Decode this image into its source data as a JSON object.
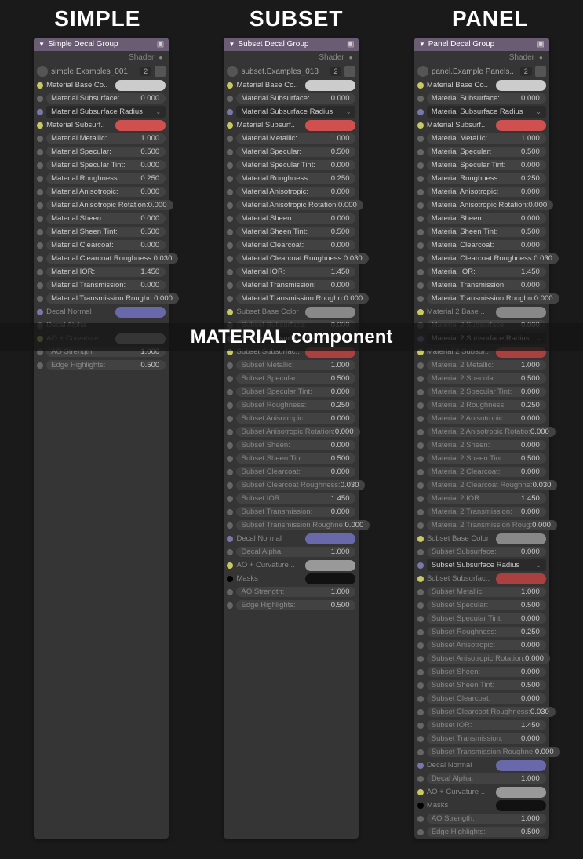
{
  "titles": {
    "simple": "SIMPLE",
    "subset": "SUBSET",
    "panel": "PANEL"
  },
  "overlay": "MATERIAL component",
  "shader_label": "Shader",
  "simple": {
    "header": "Simple Decal Group",
    "example": "simple.Examples_001",
    "count": "2",
    "rows": [
      {
        "dot": "yellow",
        "label": "Material Base Co..",
        "swatch": "#cccccc"
      },
      {
        "dot": "gray",
        "label": "Material Subsurface:",
        "value": "0.000",
        "field": true
      },
      {
        "dot": "purple",
        "select": "Material Subsurface Radius"
      },
      {
        "dot": "yellow",
        "label": "Material Subsurf..",
        "swatch": "#d05050"
      },
      {
        "dot": "gray",
        "label": "Material Metallic:",
        "value": "1.000",
        "field": true
      },
      {
        "dot": "gray",
        "label": "Material Specular:",
        "value": "0.500",
        "field": true
      },
      {
        "dot": "gray",
        "label": "Material Specular Tint:",
        "value": "0.000",
        "field": true
      },
      {
        "dot": "gray",
        "label": "Material Roughness:",
        "value": "0.250",
        "field": true
      },
      {
        "dot": "gray",
        "label": "Material Anisotropic:",
        "value": "0.000",
        "field": true
      },
      {
        "dot": "gray",
        "label": "Material Anisotropic Rotation:",
        "value": "0.000",
        "field": true
      },
      {
        "dot": "gray",
        "label": "Material Sheen:",
        "value": "0.000",
        "field": true
      },
      {
        "dot": "gray",
        "label": "Material Sheen Tint:",
        "value": "0.500",
        "field": true
      },
      {
        "dot": "gray",
        "label": "Material Clearcoat:",
        "value": "0.000",
        "field": true
      },
      {
        "dot": "gray",
        "label": "Material Clearcoat Roughness:",
        "value": "0.030",
        "field": true
      },
      {
        "dot": "gray",
        "label": "Material IOR:",
        "value": "1.450",
        "field": true
      },
      {
        "dot": "gray",
        "label": "Material Transmission:",
        "value": "0.000",
        "field": true
      },
      {
        "dot": "gray",
        "label": "Material Transmission Roughn:",
        "value": "0.000",
        "field": true
      },
      {
        "dot": "purple",
        "label": "Decal Normal",
        "swatch": "#6868aa",
        "dim": true
      },
      {
        "dot": "gray",
        "label": "Decal Alpha",
        "dim": true
      },
      {
        "dot": "yellow",
        "label": "AO + Curvature ..",
        "swatch": "#999999",
        "dim": true
      },
      {
        "dot": "gray",
        "label": "AO Strength:",
        "value": "1.000",
        "field": true,
        "dim": true
      },
      {
        "dot": "gray",
        "label": "Edge Highlights:",
        "value": "0.500",
        "field": true,
        "dim": true
      }
    ]
  },
  "subset": {
    "header": "Subset Decal Group",
    "example": "subset.Examples_018",
    "count": "2",
    "rows": [
      {
        "dot": "yellow",
        "label": "Material Base Co..",
        "swatch": "#cccccc"
      },
      {
        "dot": "gray",
        "label": "Material Subsurface:",
        "value": "0.000",
        "field": true
      },
      {
        "dot": "purple",
        "select": "Material Subsurface Radius"
      },
      {
        "dot": "yellow",
        "label": "Material Subsurf..",
        "swatch": "#d05050"
      },
      {
        "dot": "gray",
        "label": "Material Metallic:",
        "value": "1.000",
        "field": true
      },
      {
        "dot": "gray",
        "label": "Material Specular:",
        "value": "0.500",
        "field": true
      },
      {
        "dot": "gray",
        "label": "Material Specular Tint:",
        "value": "0.000",
        "field": true
      },
      {
        "dot": "gray",
        "label": "Material Roughness:",
        "value": "0.250",
        "field": true
      },
      {
        "dot": "gray",
        "label": "Material Anisotropic:",
        "value": "0.000",
        "field": true
      },
      {
        "dot": "gray",
        "label": "Material Anisotropic Rotation:",
        "value": "0.000",
        "field": true
      },
      {
        "dot": "gray",
        "label": "Material Sheen:",
        "value": "0.000",
        "field": true
      },
      {
        "dot": "gray",
        "label": "Material Sheen Tint:",
        "value": "0.500",
        "field": true
      },
      {
        "dot": "gray",
        "label": "Material Clearcoat:",
        "value": "0.000",
        "field": true
      },
      {
        "dot": "gray",
        "label": "Material Clearcoat Roughness:",
        "value": "0.030",
        "field": true
      },
      {
        "dot": "gray",
        "label": "Material IOR:",
        "value": "1.450",
        "field": true
      },
      {
        "dot": "gray",
        "label": "Material Transmission:",
        "value": "0.000",
        "field": true
      },
      {
        "dot": "gray",
        "label": "Material Transmission Roughn:",
        "value": "0.000",
        "field": true
      },
      {
        "dot": "yellow",
        "label": "Subset Base Color",
        "swatch": "#888888",
        "dim": true
      },
      {
        "dot": "gray",
        "label": "Subset Subsurface:",
        "value": "0.000",
        "field": true,
        "dim": true
      },
      {
        "dot": "purple",
        "select": "Subset Subsurface Radius",
        "dim": true
      },
      {
        "dot": "yellow",
        "label": "Subset Subsurfac..",
        "swatch": "#aa4040",
        "dim": true
      },
      {
        "dot": "gray",
        "label": "Subset Metallic:",
        "value": "1.000",
        "field": true,
        "dim": true
      },
      {
        "dot": "gray",
        "label": "Subset Specular:",
        "value": "0.500",
        "field": true,
        "dim": true
      },
      {
        "dot": "gray",
        "label": "Subset Specular Tint:",
        "value": "0.000",
        "field": true,
        "dim": true
      },
      {
        "dot": "gray",
        "label": "Subset Roughness:",
        "value": "0.250",
        "field": true,
        "dim": true
      },
      {
        "dot": "gray",
        "label": "Subset Anisotropic:",
        "value": "0.000",
        "field": true,
        "dim": true
      },
      {
        "dot": "gray",
        "label": "Subset Anisotropic Rotation:",
        "value": "0.000",
        "field": true,
        "dim": true
      },
      {
        "dot": "gray",
        "label": "Subset Sheen:",
        "value": "0.000",
        "field": true,
        "dim": true
      },
      {
        "dot": "gray",
        "label": "Subset Sheen Tint:",
        "value": "0.500",
        "field": true,
        "dim": true
      },
      {
        "dot": "gray",
        "label": "Subset Clearcoat:",
        "value": "0.000",
        "field": true,
        "dim": true
      },
      {
        "dot": "gray",
        "label": "Subset Clearcoat Roughness:",
        "value": "0.030",
        "field": true,
        "dim": true
      },
      {
        "dot": "gray",
        "label": "Subset IOR:",
        "value": "1.450",
        "field": true,
        "dim": true
      },
      {
        "dot": "gray",
        "label": "Subset Transmission:",
        "value": "0.000",
        "field": true,
        "dim": true
      },
      {
        "dot": "gray",
        "label": "Subset Transmission Roughne:",
        "value": "0.000",
        "field": true,
        "dim": true
      },
      {
        "dot": "purple",
        "label": "Decal Normal",
        "swatch": "#6868aa",
        "dim": true
      },
      {
        "dot": "gray",
        "label": "Decal Alpha:",
        "value": "1.000",
        "field": true,
        "dim": true
      },
      {
        "dot": "yellow",
        "label": "AO + Curvature ..",
        "swatch": "#999999",
        "dim": true
      },
      {
        "dot": "black",
        "label": "Masks",
        "swatch": "#111111",
        "dim": true
      },
      {
        "dot": "gray",
        "label": "AO Strength:",
        "value": "1.000",
        "field": true,
        "dim": true
      },
      {
        "dot": "gray",
        "label": "Edge Highlights:",
        "value": "0.500",
        "field": true,
        "dim": true
      }
    ]
  },
  "panel": {
    "header": "Panel Decal Group",
    "example": "panel.Example Panels..",
    "count": "2",
    "rows": [
      {
        "dot": "yellow",
        "label": "Material Base Co..",
        "swatch": "#cccccc"
      },
      {
        "dot": "gray",
        "label": "Material Subsurface:",
        "value": "0.000",
        "field": true
      },
      {
        "dot": "purple",
        "select": "Material Subsurface Radius"
      },
      {
        "dot": "yellow",
        "label": "Material Subsurf..",
        "swatch": "#d05050"
      },
      {
        "dot": "gray",
        "label": "Material Metallic:",
        "value": "1.000",
        "field": true
      },
      {
        "dot": "gray",
        "label": "Material Specular:",
        "value": "0.500",
        "field": true
      },
      {
        "dot": "gray",
        "label": "Material Specular Tint:",
        "value": "0.000",
        "field": true
      },
      {
        "dot": "gray",
        "label": "Material Roughness:",
        "value": "0.250",
        "field": true
      },
      {
        "dot": "gray",
        "label": "Material Anisotropic:",
        "value": "0.000",
        "field": true
      },
      {
        "dot": "gray",
        "label": "Material Anisotropic Rotation:",
        "value": "0.000",
        "field": true
      },
      {
        "dot": "gray",
        "label": "Material Sheen:",
        "value": "0.000",
        "field": true
      },
      {
        "dot": "gray",
        "label": "Material Sheen Tint:",
        "value": "0.500",
        "field": true
      },
      {
        "dot": "gray",
        "label": "Material Clearcoat:",
        "value": "0.000",
        "field": true
      },
      {
        "dot": "gray",
        "label": "Material Clearcoat Roughness:",
        "value": "0.030",
        "field": true
      },
      {
        "dot": "gray",
        "label": "Material IOR:",
        "value": "1.450",
        "field": true
      },
      {
        "dot": "gray",
        "label": "Material Transmission:",
        "value": "0.000",
        "field": true
      },
      {
        "dot": "gray",
        "label": "Material Transmission Roughn:",
        "value": "0.000",
        "field": true
      },
      {
        "dot": "yellow",
        "label": "Material 2 Base ..",
        "swatch": "#888888",
        "dim": true
      },
      {
        "dot": "gray",
        "label": "Material 2 Subsurface:",
        "value": "0.000",
        "field": true,
        "dim": true
      },
      {
        "dot": "purple",
        "select": "Material 2 Subsurface Radius",
        "dim": true
      },
      {
        "dot": "yellow",
        "label": "Material 2 Subsur..",
        "swatch": "#aa4040",
        "dim": true
      },
      {
        "dot": "gray",
        "label": "Material 2 Metallic:",
        "value": "1.000",
        "field": true,
        "dim": true
      },
      {
        "dot": "gray",
        "label": "Material 2 Specular:",
        "value": "0.500",
        "field": true,
        "dim": true
      },
      {
        "dot": "gray",
        "label": "Material 2 Specular Tint:",
        "value": "0.000",
        "field": true,
        "dim": true
      },
      {
        "dot": "gray",
        "label": "Material 2 Roughness:",
        "value": "0.250",
        "field": true,
        "dim": true
      },
      {
        "dot": "gray",
        "label": "Material 2 Anisotropic:",
        "value": "0.000",
        "field": true,
        "dim": true
      },
      {
        "dot": "gray",
        "label": "Material 2 Anisotropic Rotatio:",
        "value": "0.000",
        "field": true,
        "dim": true
      },
      {
        "dot": "gray",
        "label": "Material 2 Sheen:",
        "value": "0.000",
        "field": true,
        "dim": true
      },
      {
        "dot": "gray",
        "label": "Material 2 Sheen Tint:",
        "value": "0.500",
        "field": true,
        "dim": true
      },
      {
        "dot": "gray",
        "label": "Material 2 Clearcoat:",
        "value": "0.000",
        "field": true,
        "dim": true
      },
      {
        "dot": "gray",
        "label": "Material 2 Clearcoat Roughne:",
        "value": "0.030",
        "field": true,
        "dim": true
      },
      {
        "dot": "gray",
        "label": "Material 2 IOR:",
        "value": "1.450",
        "field": true,
        "dim": true
      },
      {
        "dot": "gray",
        "label": "Material 2 Transmission:",
        "value": "0.000",
        "field": true,
        "dim": true
      },
      {
        "dot": "gray",
        "label": "Material 2 Transmission Roug:",
        "value": "0.000",
        "field": true,
        "dim": true
      },
      {
        "dot": "yellow",
        "label": "Subset Base Color",
        "swatch": "#888888",
        "dim": true
      },
      {
        "dot": "gray",
        "label": "Subset Subsurface:",
        "value": "0.000",
        "field": true,
        "dim": true
      },
      {
        "dot": "purple",
        "select": "Subset Subsurface Radius",
        "dim": true
      },
      {
        "dot": "yellow",
        "label": "Subset Subsurfac..",
        "swatch": "#aa4040",
        "dim": true
      },
      {
        "dot": "gray",
        "label": "Subset Metallic:",
        "value": "1.000",
        "field": true,
        "dim": true
      },
      {
        "dot": "gray",
        "label": "Subset Specular:",
        "value": "0.500",
        "field": true,
        "dim": true
      },
      {
        "dot": "gray",
        "label": "Subset Specular Tint:",
        "value": "0.000",
        "field": true,
        "dim": true
      },
      {
        "dot": "gray",
        "label": "Subset Roughness:",
        "value": "0.250",
        "field": true,
        "dim": true
      },
      {
        "dot": "gray",
        "label": "Subset Anisotropic:",
        "value": "0.000",
        "field": true,
        "dim": true
      },
      {
        "dot": "gray",
        "label": "Subset Anisotropic Rotation:",
        "value": "0.000",
        "field": true,
        "dim": true
      },
      {
        "dot": "gray",
        "label": "Subset Sheen:",
        "value": "0.000",
        "field": true,
        "dim": true
      },
      {
        "dot": "gray",
        "label": "Subset Sheen Tint:",
        "value": "0.500",
        "field": true,
        "dim": true
      },
      {
        "dot": "gray",
        "label": "Subset Clearcoat:",
        "value": "0.000",
        "field": true,
        "dim": true
      },
      {
        "dot": "gray",
        "label": "Subset Clearcoat Roughness:",
        "value": "0.030",
        "field": true,
        "dim": true
      },
      {
        "dot": "gray",
        "label": "Subset IOR:",
        "value": "1.450",
        "field": true,
        "dim": true
      },
      {
        "dot": "gray",
        "label": "Subset Transmission:",
        "value": "0.000",
        "field": true,
        "dim": true
      },
      {
        "dot": "gray",
        "label": "Subset Transmission Roughne:",
        "value": "0.000",
        "field": true,
        "dim": true
      },
      {
        "dot": "purple",
        "label": "Decal Normal",
        "swatch": "#6868aa",
        "dim": true
      },
      {
        "dot": "gray",
        "label": "Decal Alpha:",
        "value": "1.000",
        "field": true,
        "dim": true
      },
      {
        "dot": "yellow",
        "label": "AO + Curvature ..",
        "swatch": "#999999",
        "dim": true
      },
      {
        "dot": "black",
        "label": "Masks",
        "swatch": "#111111",
        "dim": true
      },
      {
        "dot": "gray",
        "label": "AO Strength:",
        "value": "1.000",
        "field": true,
        "dim": true
      },
      {
        "dot": "gray",
        "label": "Edge Highlights:",
        "value": "0.500",
        "field": true,
        "dim": true
      }
    ]
  }
}
